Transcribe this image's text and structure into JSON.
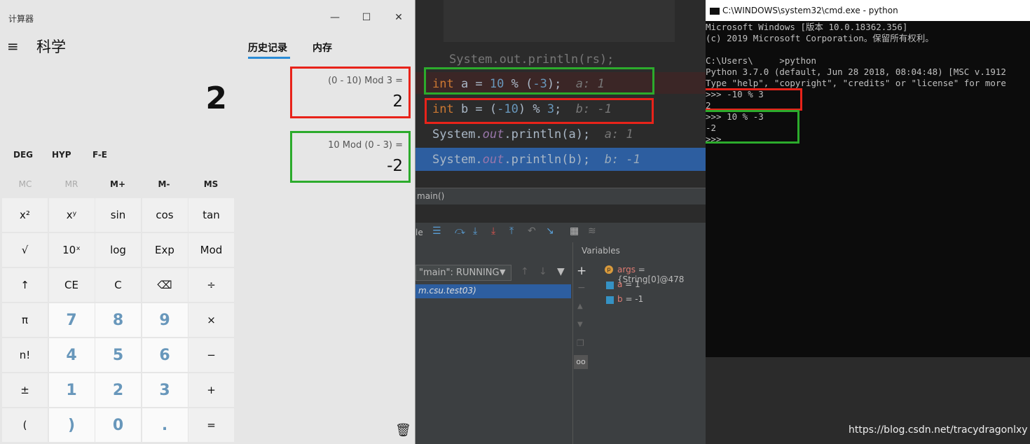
{
  "calculator": {
    "title": "计算器",
    "minimize": "—",
    "maximize": "☐",
    "close": "✕",
    "menu_icon": "≡",
    "mode": "科学",
    "display": "2",
    "tabs": [
      "历史记录",
      "内存"
    ],
    "history": [
      {
        "expr": "(0 - 10) Mod 3 =",
        "result": "2"
      },
      {
        "expr": "10 Mod (0 - 3) =",
        "result": "-2"
      }
    ],
    "angle_modes": [
      "DEG",
      "HYP",
      "F-E"
    ],
    "memory": [
      "MC",
      "MR",
      "M+",
      "M-",
      "MS"
    ],
    "keys": [
      [
        "x²",
        "xʸ",
        "sin",
        "cos",
        "tan"
      ],
      [
        "√",
        "10ˣ",
        "log",
        "Exp",
        "Mod"
      ],
      [
        "↑",
        "CE",
        "C",
        "⌫",
        "÷"
      ],
      [
        "π",
        "7",
        "8",
        "9",
        "×"
      ],
      [
        "n!",
        "4",
        "5",
        "6",
        "−"
      ],
      [
        "±",
        "1",
        "2",
        "3",
        "+"
      ],
      [
        "(",
        ")",
        "0",
        ".",
        "="
      ]
    ],
    "trash_icon": "🗑"
  },
  "ide": {
    "line0": "System.out.println(rs);",
    "line_a": {
      "kw": "int",
      "rest1": " a = ",
      "n1": "10",
      "rest2": " % (",
      "n2": "-3",
      "rest3": ");",
      "hint": "a: 1"
    },
    "line_b": {
      "kw": "int",
      "rest1": " b = (",
      "n1": "-10",
      "rest2": ") % ",
      "n2": "3",
      "rest3": ";",
      "hint": "b: -1"
    },
    "line_pa": {
      "pre": "System.",
      "out": "out",
      "post": ".println(a);",
      "hint": "a: 1"
    },
    "line_pb": {
      "pre": "System.",
      "out": "out",
      "post": ".println(b);",
      "hint": "b: -1"
    },
    "breadcrumb": "main()",
    "toolbar_label": "le",
    "variables_header": "Variables",
    "thread": "\"main\": RUNNING",
    "frame": "m.csu.test03)",
    "variables": [
      {
        "name": "args",
        "value": " = {String[0]@478"
      },
      {
        "name": "a",
        "value": " = 1"
      },
      {
        "name": "b",
        "value": " = -1"
      }
    ]
  },
  "cmd": {
    "title": "C:\\WINDOWS\\system32\\cmd.exe - python",
    "lines": [
      "Microsoft Windows [版本 10.0.18362.356]",
      "(c) 2019 Microsoft Corporation。保留所有权利。",
      "",
      "C:\\Users\\     >python",
      "Python 3.7.0 (default, Jun 28 2018, 08:04:48) [MSC v.1912",
      "Type \"help\", \"copyright\", \"credits\" or \"license\" for more",
      ">>> -10 % 3",
      "2",
      ">>> 10 % -3",
      "-2",
      ">>>"
    ]
  },
  "watermark": "https://blog.csdn.net/tracydragonlxy"
}
